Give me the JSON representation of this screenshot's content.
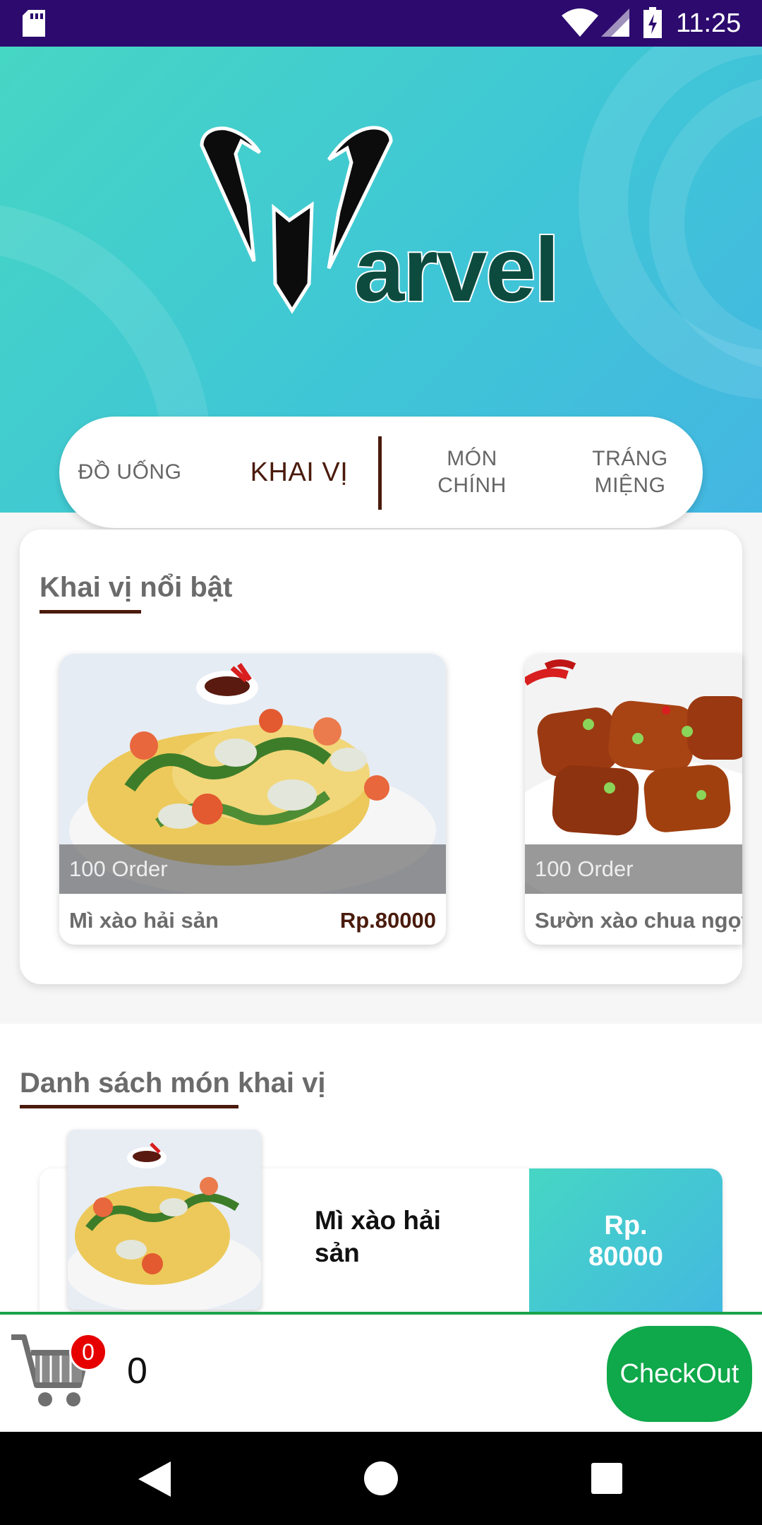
{
  "status_bar": {
    "time": "11:25",
    "icons": [
      "sd-card-icon",
      "wifi-icon",
      "signal-icon",
      "battery-charging-icon"
    ]
  },
  "logo": {
    "text": "arvel"
  },
  "tabs": [
    {
      "label": "ĐỒ UỐNG"
    },
    {
      "label": "KHAI VỊ",
      "active": true
    },
    {
      "label": "MÓN CHÍNH"
    },
    {
      "label": "TRÁNG MIỆNG"
    }
  ],
  "featured": {
    "title": "Khai vị nổi bật",
    "items": [
      {
        "orders": "100 Order",
        "name": "Mì xào hải sản",
        "price": "Rp.80000"
      },
      {
        "orders": "100 Order",
        "name": "Sườn xào chua ngọt",
        "price": ""
      }
    ]
  },
  "list": {
    "title": "Danh sách món khai vị",
    "items": [
      {
        "name": "Mì xào hải sản",
        "price_prefix": "Rp.",
        "price_value": "80000"
      }
    ]
  },
  "cart": {
    "badge": "0",
    "count": "0",
    "checkout_label": "CheckOut"
  },
  "colors": {
    "accent": "#4a1b0c",
    "status_bar": "#2c0a6e",
    "checkout": "#0fa84a",
    "header_start": "#46d6c4",
    "header_end": "#44b6e2"
  }
}
